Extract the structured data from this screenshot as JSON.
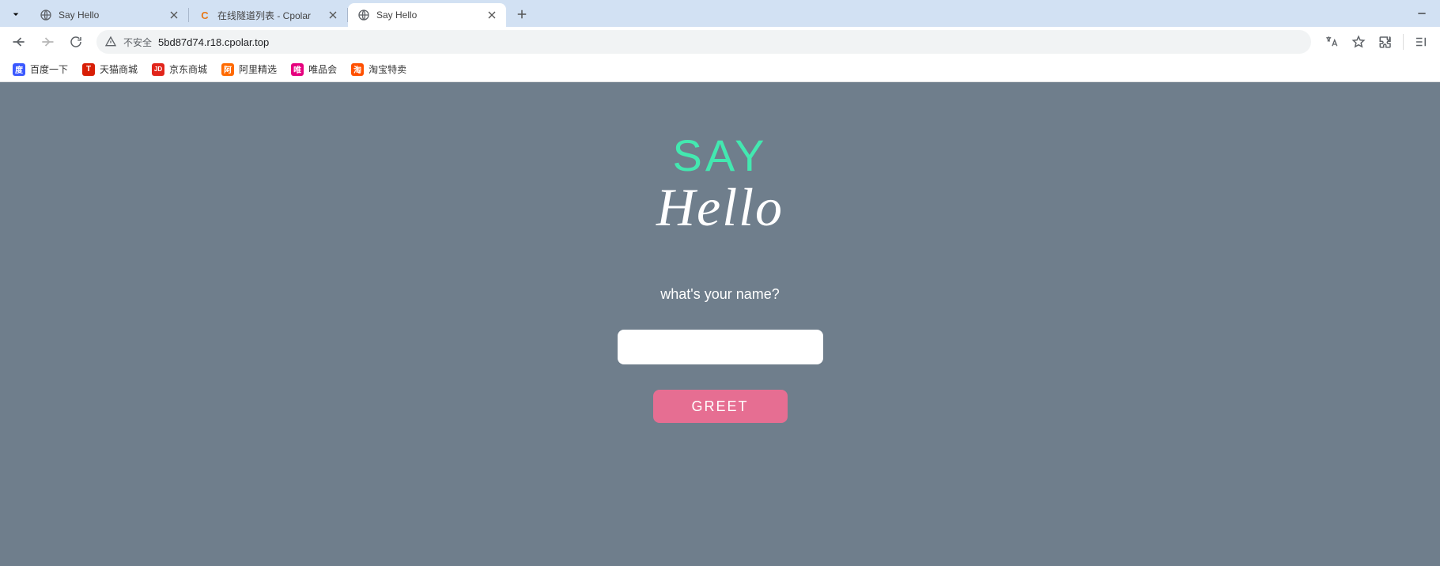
{
  "tabs": [
    {
      "title": "Say Hello",
      "favicon": "globe"
    },
    {
      "title": "在线隧道列表 - Cpolar",
      "favicon": "c-orange"
    },
    {
      "title": "Say Hello",
      "favicon": "globe",
      "active": true
    }
  ],
  "addressbar": {
    "security_label": "不安全",
    "url": "5bd87d74.r18.cpolar.top"
  },
  "bookmarks": [
    {
      "label": "百度一下",
      "icon_bg": "#3b59ff",
      "glyph": "🐾"
    },
    {
      "label": "天猫商城",
      "icon_bg": "#d81e06",
      "glyph": "T"
    },
    {
      "label": "京东商城",
      "icon_bg": "#e1251b",
      "glyph": "JD"
    },
    {
      "label": "阿里精选",
      "icon_bg": "#ff6a00",
      "glyph": "🛒"
    },
    {
      "label": "唯品会",
      "icon_bg": "#e6007e",
      "glyph": "唯"
    },
    {
      "label": "淘宝特卖",
      "icon_bg": "#ff5000",
      "glyph": "淘"
    }
  ],
  "page": {
    "heading_line1": "SAY",
    "heading_line2": "Hello",
    "prompt": "what's your name?",
    "input_value": "",
    "button_label": "GREET"
  }
}
